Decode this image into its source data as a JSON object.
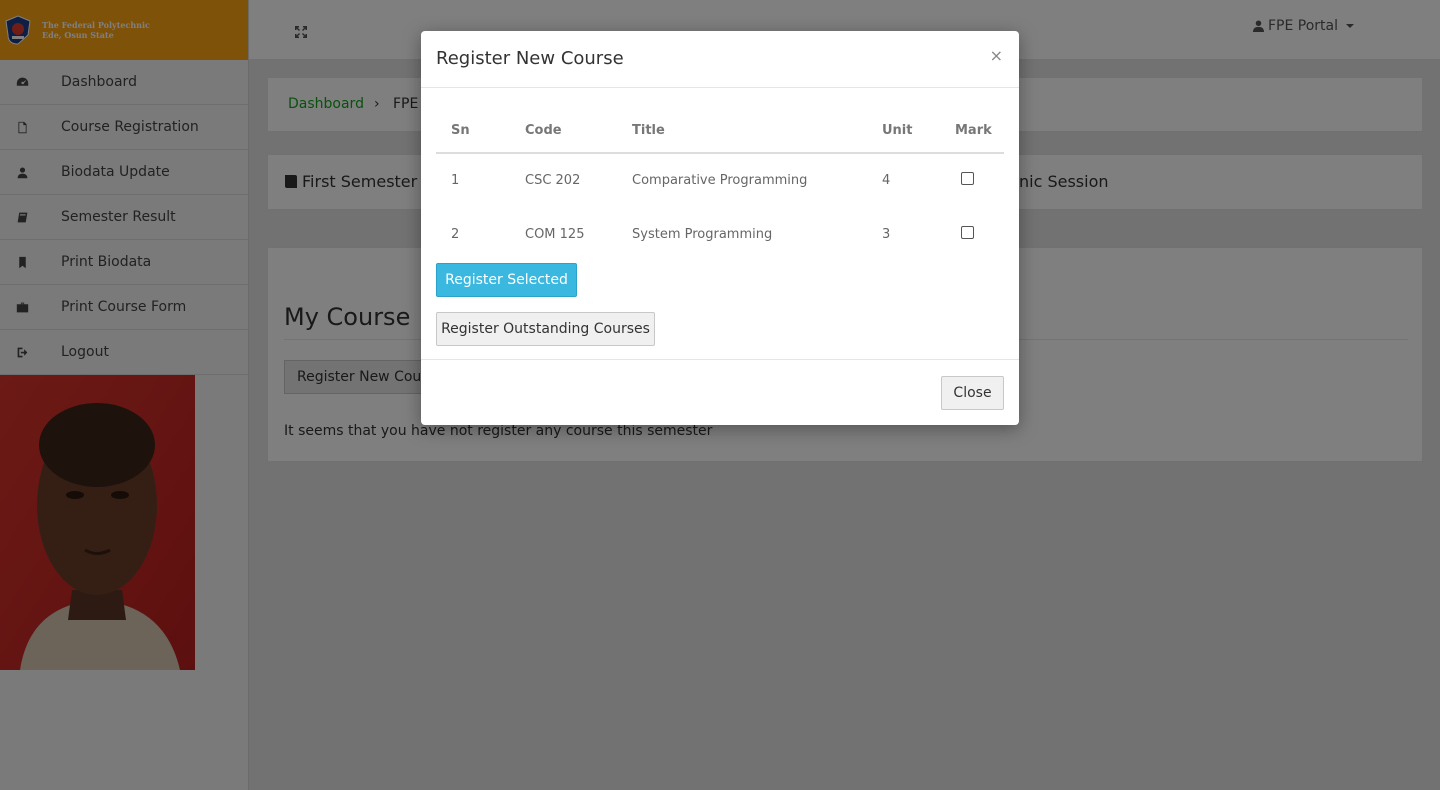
{
  "brand": {
    "line1": "The Federal Polytechnic",
    "line2": "Ede, Osun State"
  },
  "sidebar": {
    "items": [
      {
        "label": "Dashboard",
        "icon": "dashboard-icon"
      },
      {
        "label": "Course Registration",
        "icon": "file-icon"
      },
      {
        "label": "Biodata Update",
        "icon": "user-icon"
      },
      {
        "label": "Semester Result",
        "icon": "book-icon"
      },
      {
        "label": "Print Biodata",
        "icon": "bookmark-icon"
      },
      {
        "label": "Print Course Form",
        "icon": "briefcase-icon"
      },
      {
        "label": "Logout",
        "icon": "sign-out-icon"
      }
    ]
  },
  "topbar": {
    "portal_label": "FPE Portal"
  },
  "breadcrumb": {
    "home": "Dashboard",
    "separator": "›",
    "current": "FPE"
  },
  "semester": {
    "title": "First Semester",
    "session_suffix": "nic Session"
  },
  "course_panel": {
    "heading": "My Course",
    "register_new_button": "Register New Course",
    "empty_message": "It seems that you have not register any course this semester"
  },
  "modal": {
    "title": "Register New Course",
    "close_x": "×",
    "columns": [
      "Sn",
      "Code",
      "Title",
      "Unit",
      "Mark"
    ],
    "rows": [
      {
        "sn": "1",
        "code": "CSC 202",
        "title": "Comparative Programming",
        "unit": "4"
      },
      {
        "sn": "2",
        "code": "COM 125",
        "title": "System Programming",
        "unit": "3"
      }
    ],
    "register_selected_button": "Register Selected",
    "register_outstanding_button": "Register Outstanding Courses",
    "close_button": "Close"
  },
  "colors": {
    "brand": "#ffa415",
    "link_green": "#15a31e",
    "primary_button": "#3ab8e0"
  }
}
